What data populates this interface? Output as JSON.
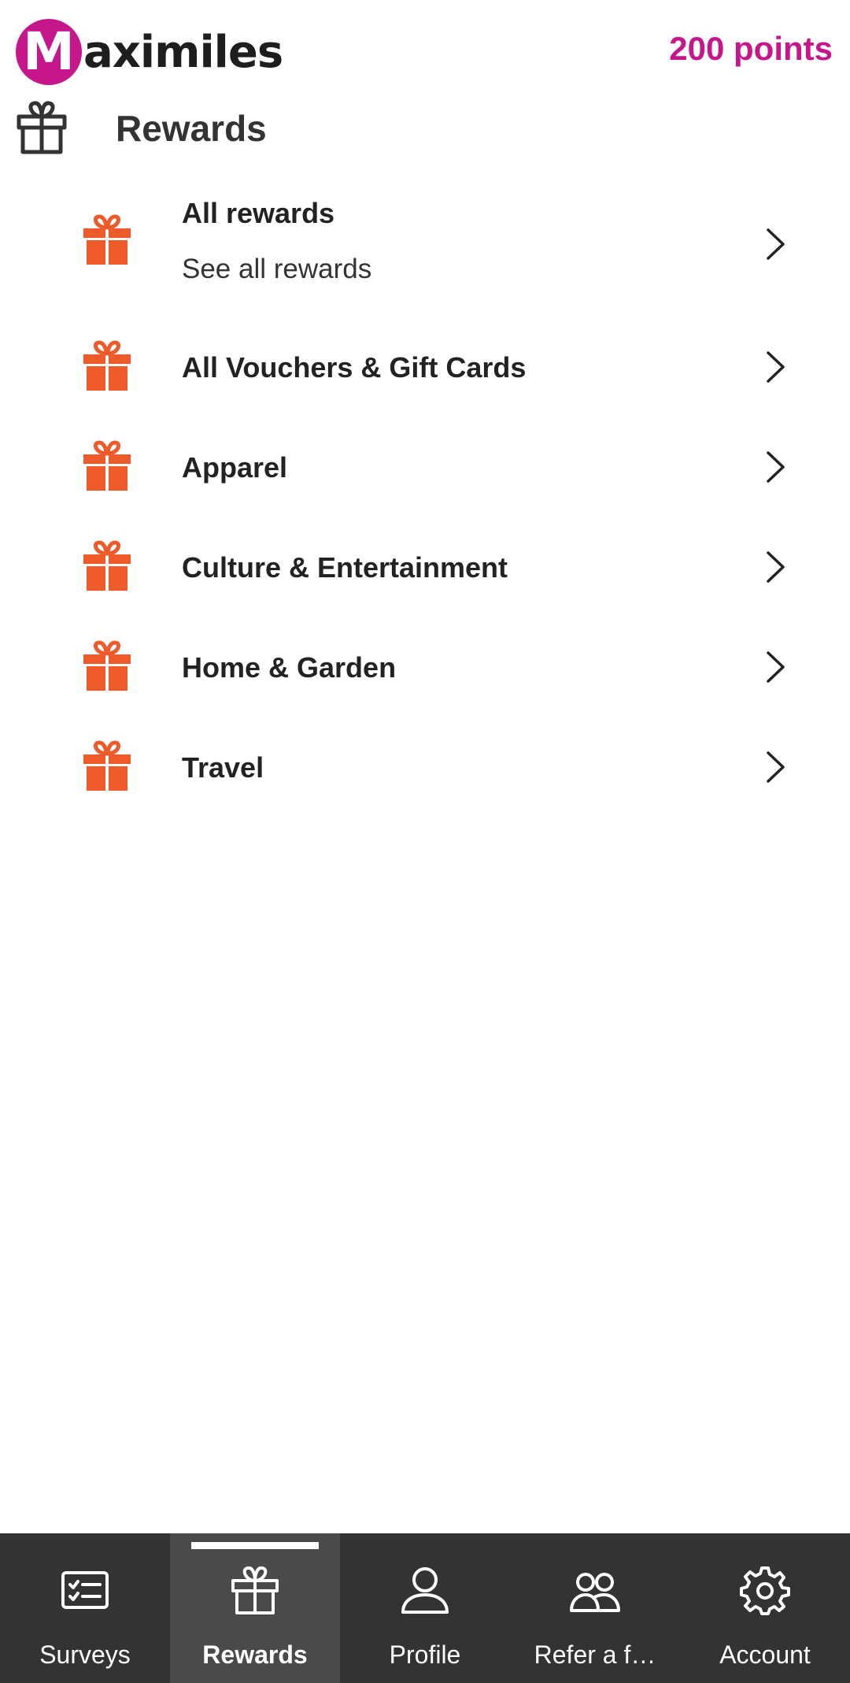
{
  "header": {
    "logo_letter": "M",
    "logo_text": "aximiles",
    "points": "200 points"
  },
  "page": {
    "title": "Rewards",
    "title_icon": "gift-outline-icon"
  },
  "rewards_list": [
    {
      "label": "All rewards",
      "sublabel": "See all rewards",
      "icon": "gift-icon"
    },
    {
      "label": "All Vouchers & Gift Cards",
      "icon": "gift-icon"
    },
    {
      "label": "Apparel",
      "icon": "gift-icon"
    },
    {
      "label": "Culture & Entertainment",
      "icon": "gift-icon"
    },
    {
      "label": "Home & Garden",
      "icon": "gift-icon"
    },
    {
      "label": "Travel",
      "icon": "gift-icon"
    }
  ],
  "bottom_nav": {
    "active": "Rewards",
    "items": [
      {
        "label": "Surveys",
        "icon": "survey-checklist-icon"
      },
      {
        "label": "Rewards",
        "icon": "gift-outline-icon"
      },
      {
        "label": "Profile",
        "icon": "person-icon"
      },
      {
        "label": "Refer a f…",
        "icon": "people-icon"
      },
      {
        "label": "Account",
        "icon": "gear-icon"
      }
    ]
  },
  "colors": {
    "brand": "#c5168c",
    "accent_icon": "#ee5a2a",
    "nav_background": "#333333",
    "nav_active_background": "#4a4a4a",
    "text": "#222222"
  }
}
